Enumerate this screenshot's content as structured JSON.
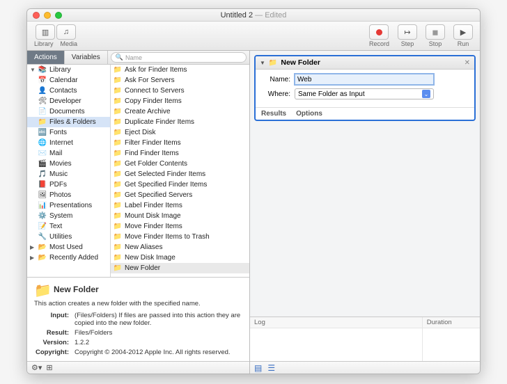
{
  "window": {
    "title": "Untitled 2",
    "edited_suffix": " — Edited"
  },
  "toolbar": {
    "library": "Library",
    "media": "Media",
    "record": "Record",
    "step": "Step",
    "stop": "Stop",
    "run": "Run"
  },
  "tabs": {
    "actions": "Actions",
    "variables": "Variables"
  },
  "search": {
    "placeholder": "Name"
  },
  "categories": {
    "root": "Library",
    "items": [
      "Calendar",
      "Contacts",
      "Developer",
      "Documents",
      "Files & Folders",
      "Fonts",
      "Internet",
      "Mail",
      "Movies",
      "Music",
      "PDFs",
      "Photos",
      "Presentations",
      "System",
      "Text",
      "Utilities"
    ],
    "footer": [
      "Most Used",
      "Recently Added"
    ],
    "selected_index": 4
  },
  "actions_list": [
    "Ask for Finder Items",
    "Ask For Servers",
    "Connect to Servers",
    "Copy Finder Items",
    "Create Archive",
    "Duplicate Finder Items",
    "Eject Disk",
    "Filter Finder Items",
    "Find Finder Items",
    "Get Folder Contents",
    "Get Selected Finder Items",
    "Get Specified Finder Items",
    "Get Specified Servers",
    "Label Finder Items",
    "Mount Disk Image",
    "Move Finder Items",
    "Move Finder Items to Trash",
    "New Aliases",
    "New Disk Image",
    "New Folder"
  ],
  "actions_selected_index": 19,
  "description": {
    "title": "New Folder",
    "summary": "This action creates a new folder with the specified name.",
    "rows": {
      "input_label": "Input:",
      "input_value": "(Files/Folders) If files are passed into this action they are copied into the new folder.",
      "result_label": "Result:",
      "result_value": "Files/Folders",
      "version_label": "Version:",
      "version_value": "1.2.2",
      "copyright_label": "Copyright:",
      "copyright_value": "Copyright © 2004-2012 Apple Inc.  All rights reserved."
    }
  },
  "workflow_action": {
    "title": "New Folder",
    "name_label": "Name:",
    "name_value": "Web",
    "where_label": "Where:",
    "where_value": "Same Folder as Input",
    "results": "Results",
    "options": "Options"
  },
  "log": {
    "log_label": "Log",
    "duration_label": "Duration"
  }
}
